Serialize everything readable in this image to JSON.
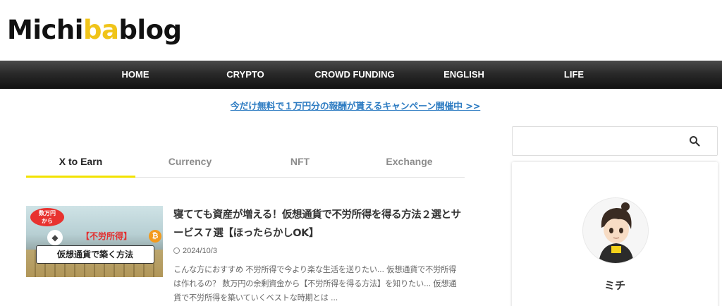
{
  "site": {
    "logo_text_1": "Michi",
    "logo_text_accent": "ba",
    "logo_text_2": "blog"
  },
  "nav": {
    "items": [
      {
        "label": "HOME"
      },
      {
        "label": "CRYPTO"
      },
      {
        "label": "CROWD FUNDING"
      },
      {
        "label": "ENGLISH"
      },
      {
        "label": "LIFE"
      }
    ]
  },
  "campaign": {
    "text": "今だけ無料で１万円分の報酬が貰えるキャンペーン開催中 >>"
  },
  "tabs": {
    "items": [
      {
        "label": "X to Earn",
        "active": true
      },
      {
        "label": "Currency"
      },
      {
        "label": "NFT"
      },
      {
        "label": "Exchange"
      }
    ]
  },
  "post": {
    "thumbnail": {
      "badge": "数万円\nから",
      "headline": "【不労所得】",
      "subline": "仮想通貨で築く方法",
      "eth_icon": "ethereum-icon",
      "btc_icon": "bitcoin-icon"
    },
    "title": "寝てても資産が増える！仮想通貨で不労所得を得る方法２選とサービス７選【ほったらかしOK】",
    "date": "2024/10/3",
    "excerpt": "こんな方におすすめ 不労所得で今より楽な生活を送りたい... 仮想通貨で不労所得は作れるの？ 数万円の余剰資金から【不労所得を得る方法】を知りたい... 仮想通貨で不労所得を築いていくベストな時期とは ..."
  },
  "sidebar": {
    "search": {
      "placeholder": "",
      "icon": "search-icon"
    },
    "profile": {
      "name": "ミチ",
      "avatar": "avatar-illustration"
    }
  },
  "colors": {
    "accent": "#f0c419",
    "link": "#2e7cc2",
    "tab_underline": "#f2e200",
    "nav_bg": "#1a1a1a"
  }
}
